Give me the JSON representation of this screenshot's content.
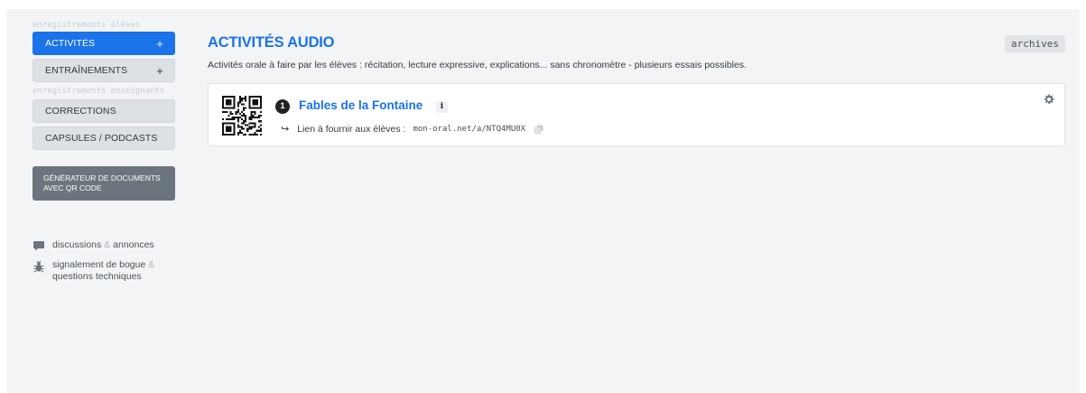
{
  "sidebar": {
    "section_students": "enregistrements élèves",
    "btn_activities": "ACTIVITÉS",
    "btn_trainings": "ENTRAÎNEMENTS",
    "plus": "+",
    "section_teachers": "enregistrements enseignants",
    "btn_corrections": "CORRECTIONS",
    "btn_capsules": "CAPSULES / PODCASTS",
    "doc_generator_line1": "GÉNÉRATEUR DE DOCUMENTS",
    "doc_generator_line2": "AVEC QR CODE",
    "discussions": "discussions",
    "amp": "&",
    "annonces": "annonces",
    "bug_line1_a": "signalement de bogue",
    "bug_line2": "questions techniques"
  },
  "main": {
    "title": "ACTIVITÉS AUDIO",
    "archives": "archives",
    "subtitle": "Activités orale à faire par les élèves : récitation, lecture expressive, explications... sans chronomètre - plusieurs essais possibles.",
    "activity": {
      "number": "1",
      "title": "Fables de la Fontaine",
      "info": "i",
      "arrow": "↪",
      "link_label": "Lien à fournir aux élèves :",
      "link_url": "mon-oral.net/a/NTQ4MU0X"
    }
  },
  "colors": {
    "accent": "#1a73e8",
    "background": "#f3f4f6",
    "dark_button": "#6c757d"
  },
  "icons": {
    "qr": "qr-code-icon",
    "settings": "gear-icon",
    "copy": "copy-icon",
    "chat": "chat-bubble-icon",
    "bug": "bug-icon",
    "plus": "plus-icon",
    "arrow": "return-arrow-icon"
  }
}
